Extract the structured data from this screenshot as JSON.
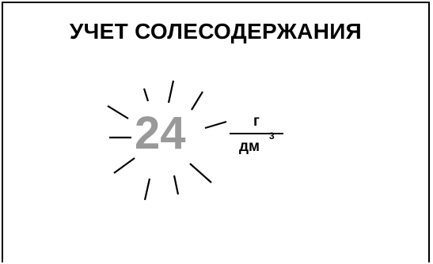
{
  "screen": {
    "title": "УЧЕТ СОЛЕСОДЕРЖАНИЯ"
  },
  "indicator": {
    "value": "24",
    "state": "blinking",
    "value_color": "#999999",
    "unit": {
      "numerator": "г",
      "denominator": "дм",
      "exponent": "3"
    }
  }
}
